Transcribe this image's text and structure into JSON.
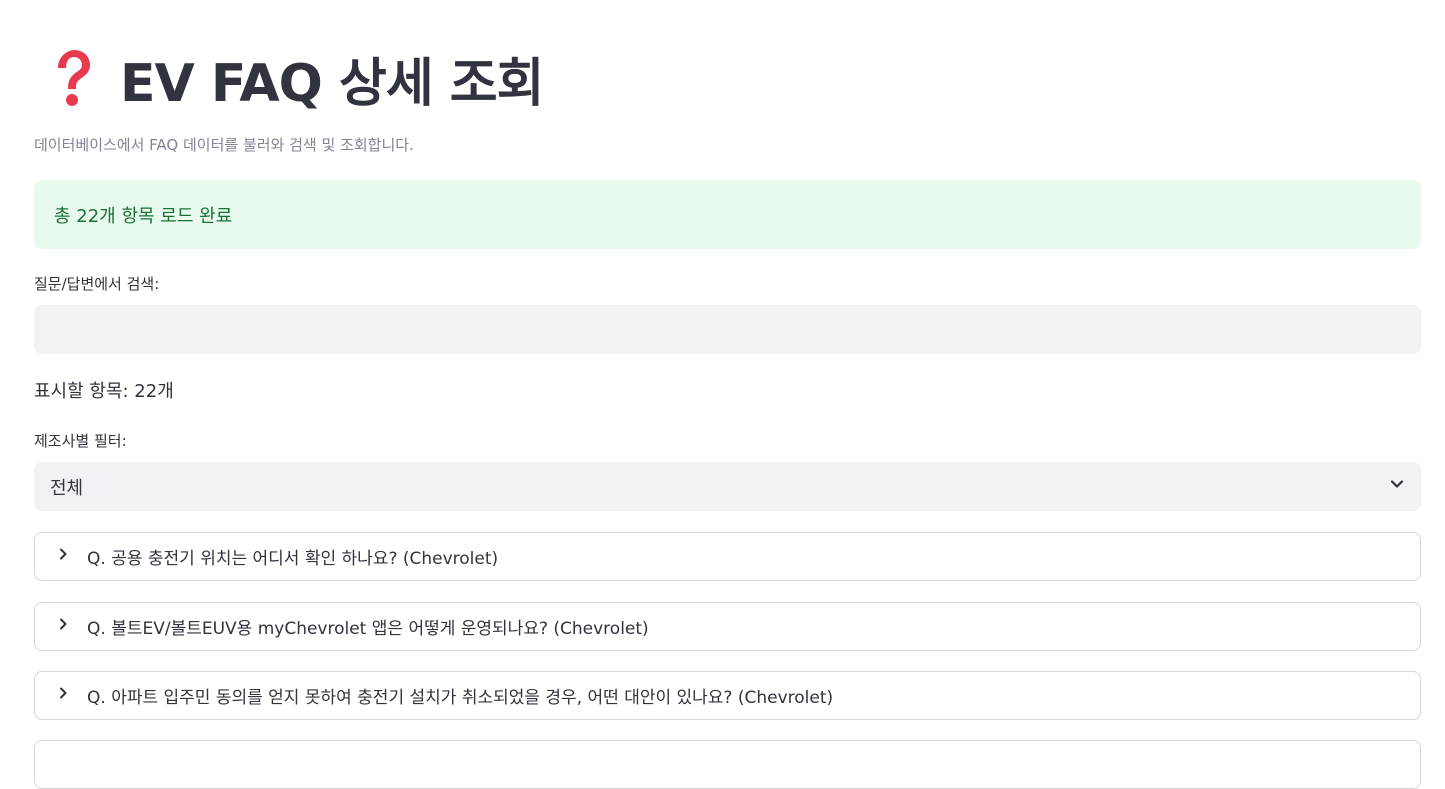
{
  "page": {
    "title": "EV FAQ 상세 조회",
    "title_icon": "red-question-mark-icon",
    "caption": "데이터베이스에서 FAQ 데이터를 불러와 검색 및 조회합니다."
  },
  "status": {
    "message": "총 22개 항목 로드 완료",
    "color": "#177233",
    "background": "#e8f9ee"
  },
  "search": {
    "label": "질문/답변에서 검색:",
    "value": ""
  },
  "display_count": "표시할 항목: 22개",
  "filter": {
    "label": "제조사별 필터:",
    "selected": "전체",
    "icon": "chevron-down-icon"
  },
  "faq_items": [
    {
      "label": "Q. 공용 충전기 위치는 어디서 확인 하나요? (Chevrolet)"
    },
    {
      "label": "Q. 볼트EV/볼트EUV용 myChevrolet 앱은 어떻게 운영되나요? (Chevrolet)"
    },
    {
      "label": "Q. 아파트 입주민 동의를 얻지 못하여 충전기 설치가 취소되었을 경우, 어떤 대안이 있나요? (Chevrolet)"
    },
    {
      "label": ""
    }
  ],
  "colors": {
    "text": "#31333f",
    "muted": "#808495",
    "input_bg": "#f0f2f6",
    "border": "#d6d6d9"
  }
}
